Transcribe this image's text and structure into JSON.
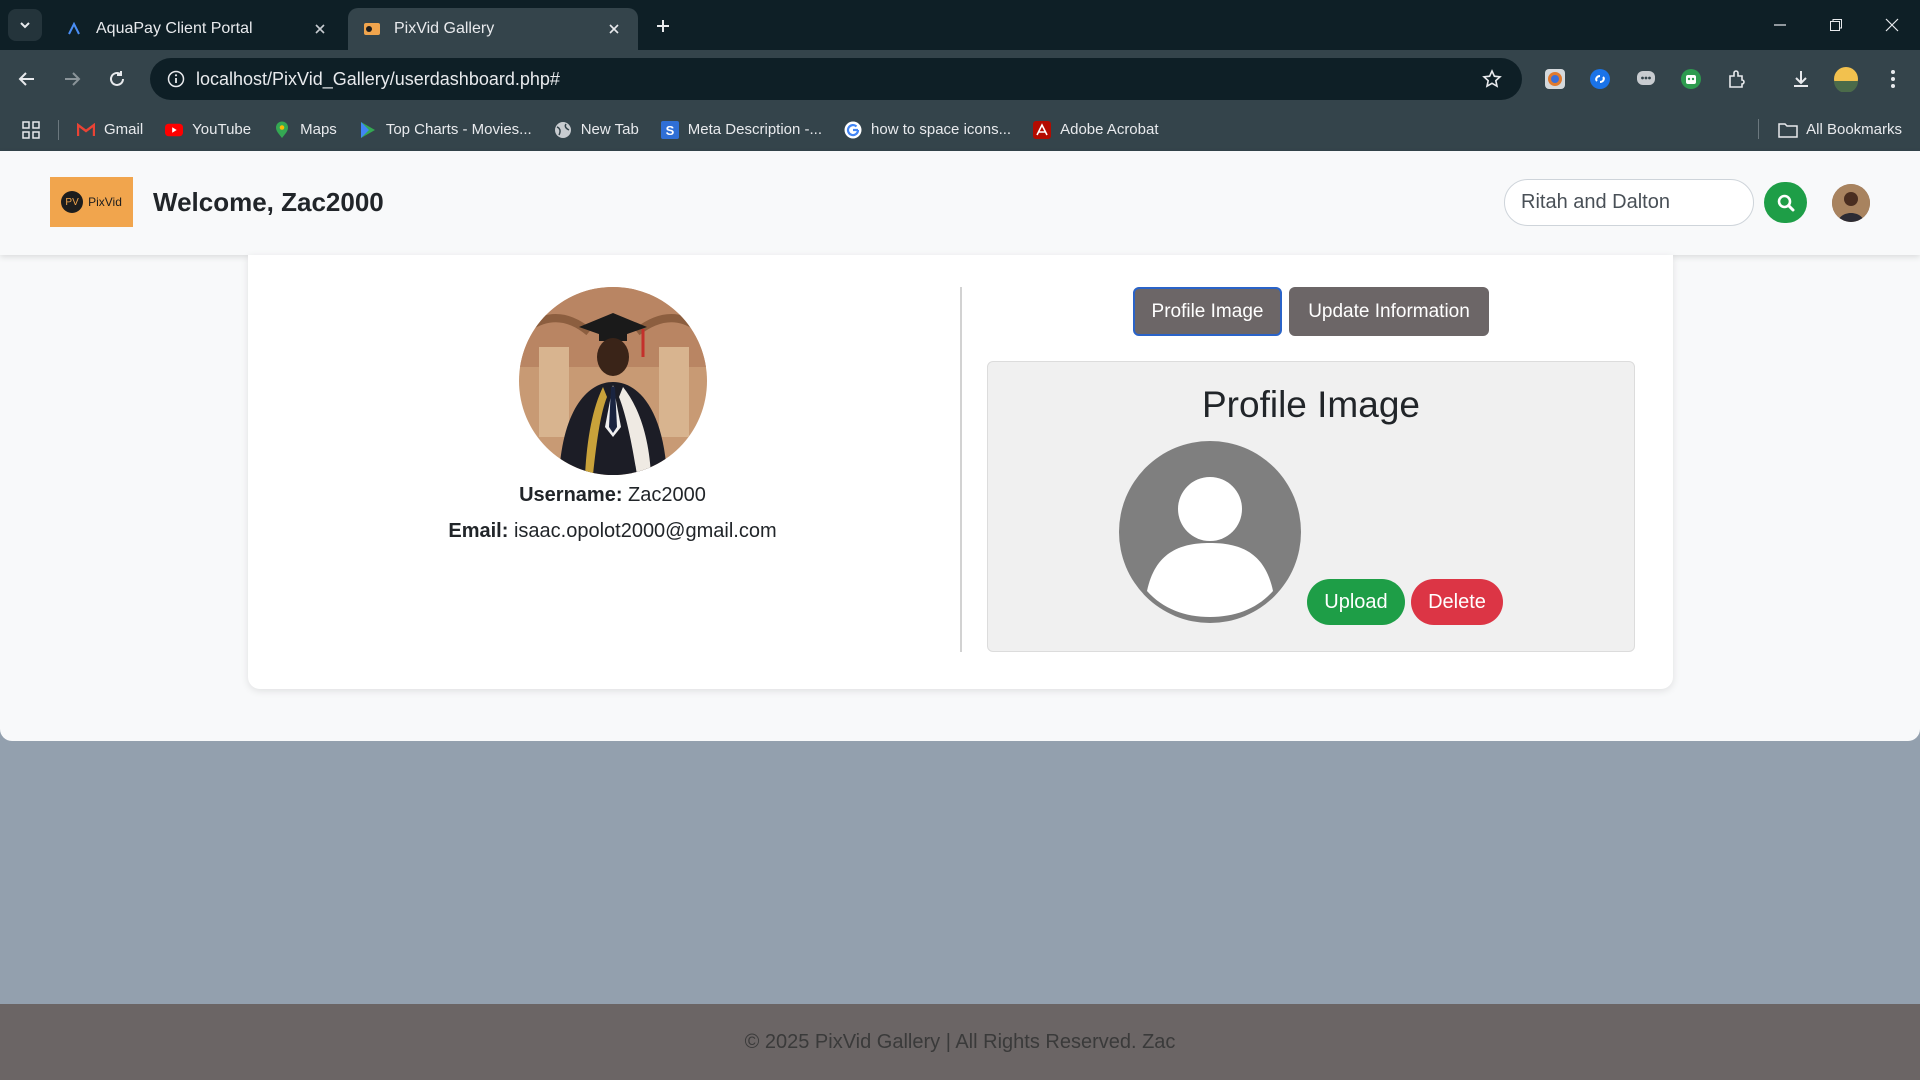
{
  "browser": {
    "tabs": [
      {
        "title": "AquaPay Client Portal",
        "active": false
      },
      {
        "title": "PixVid Gallery",
        "active": true
      }
    ],
    "url": "localhost/PixVid_Gallery/userdashboard.php#",
    "bookmarks": [
      {
        "label": "Gmail",
        "icon": "gmail-icon"
      },
      {
        "label": "YouTube",
        "icon": "youtube-icon"
      },
      {
        "label": "Maps",
        "icon": "maps-icon"
      },
      {
        "label": "Top Charts - Movies...",
        "icon": "google-play-icon"
      },
      {
        "label": "New Tab",
        "icon": "globe-icon"
      },
      {
        "label": "Meta Description -...",
        "icon": "s-logo-icon"
      },
      {
        "label": "how to space icons...",
        "icon": "google-icon"
      },
      {
        "label": "Adobe Acrobat",
        "icon": "acrobat-icon"
      }
    ],
    "all_bookmarks": "All Bookmarks"
  },
  "header": {
    "logo_mark": "PV",
    "logo_text": "PixVid",
    "welcome": "Welcome, Zac2000",
    "search_value": "Ritah and Dalton"
  },
  "profile": {
    "username_label": "Username:",
    "username": "Zac2000",
    "email_label": "Email:",
    "email": "isaac.opolot2000@gmail.com"
  },
  "panel": {
    "tab_profile_image": "Profile Image",
    "tab_update_info": "Update Information",
    "title": "Profile Image",
    "upload": "Upload",
    "delete": "Delete"
  },
  "footer": {
    "text": "© 2025 PixVid Gallery | All Rights Reserved. Zac"
  },
  "colors": {
    "accent_green": "#1e9e47",
    "danger_red": "#dc3545",
    "logo_orange": "#f1a54d",
    "button_gray": "#6c6667"
  }
}
